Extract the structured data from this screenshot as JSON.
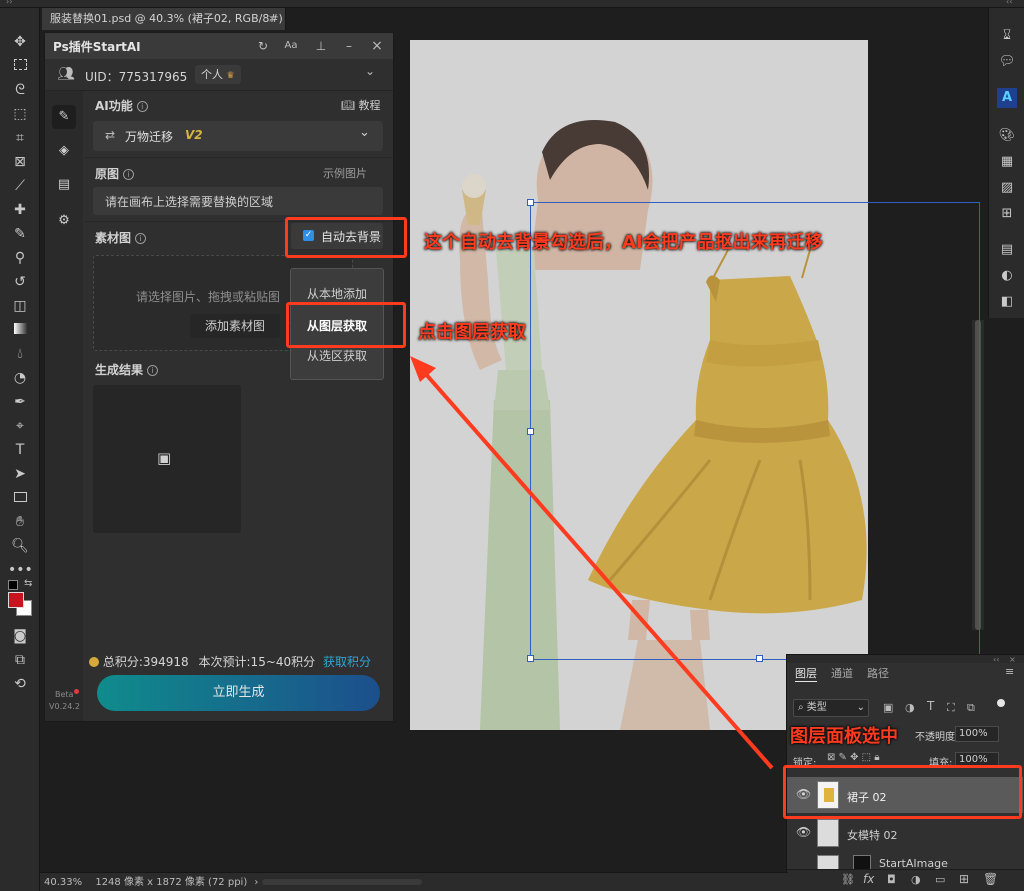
{
  "document_tab": {
    "title": "服装替换01.psd @ 40.3% (裙子02, RGB/8#) *",
    "close": "×"
  },
  "plugin": {
    "title": "Ps插件StartAI",
    "uid_label": "UID：775317965",
    "plan": "个人",
    "ai_function": {
      "label": "AI功能",
      "tutorial": "教程",
      "selected": "万物迁移",
      "version": "V2"
    },
    "original": {
      "label": "原图",
      "example": "示例图片",
      "placeholder": "请在画布上选择需要替换的区域"
    },
    "material": {
      "label": "素材图",
      "auto_bg_label": "自动去背景",
      "hint": "请选择图片、拖拽或粘贴图",
      "add_button": "添加素材图",
      "menu": [
        "从本地添加",
        "从图层获取",
        "从选区获取"
      ]
    },
    "result": {
      "label": "生成结果"
    },
    "points": {
      "total": "总积分:394918",
      "estimate": "本次预计:15~40积分",
      "get_link": "获取积分"
    },
    "generate_button": "立即生成",
    "version": {
      "beta": "Beta",
      "number": "V0.24.2"
    }
  },
  "layers_panel": {
    "tabs": [
      "图层",
      "通道",
      "路径"
    ],
    "filter": "类型",
    "opacity_label": "不透明度:",
    "opacity_value": "100%",
    "lock_label": "锁定:",
    "fill_label": "填充:",
    "fill_value": "100%",
    "layers": [
      {
        "name": "裙子 02",
        "selected": true
      },
      {
        "name": "女模特 02",
        "selected": false
      },
      {
        "name": "StartAImage",
        "selected": false
      }
    ]
  },
  "status_bar": {
    "zoom": "40.33%",
    "info": "1248 像素 x 1872 像素 (72 ppi)"
  },
  "annotations": {
    "auto_bg": "这个自动去背景勾选后，AI会把产品抠出来再迁移",
    "from_layer": "点击图层获取",
    "layer_panel": "图层面板选中"
  },
  "colors": {
    "annotation_red": "#ff3b1f",
    "dress_yellow": "#e0b43c",
    "accent_teal": "#0f8c8c",
    "link_blue": "#2fa5d8",
    "foreground_swatch": "#c8141e"
  }
}
